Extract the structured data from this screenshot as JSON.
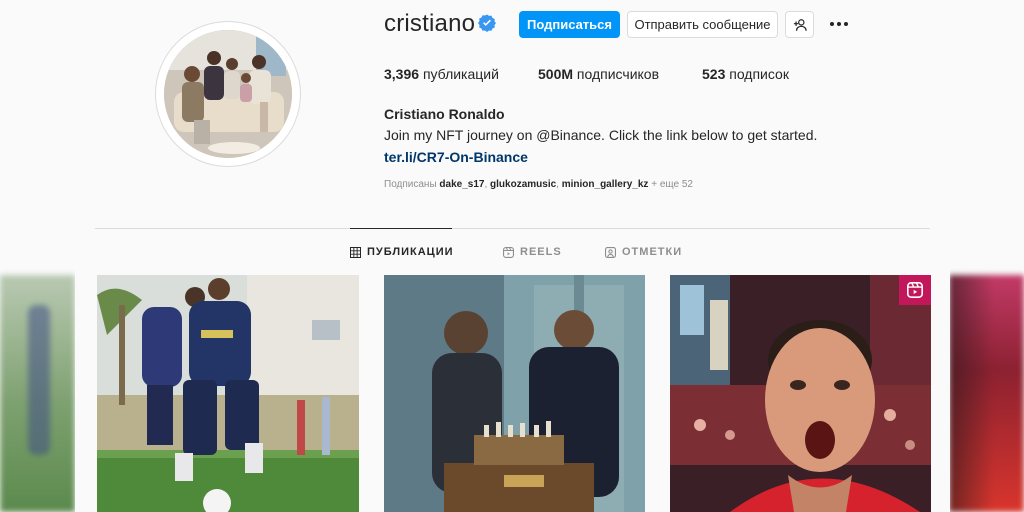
{
  "profile": {
    "username": "cristiano",
    "follow_label": "Подписаться",
    "message_label": "Отправить сообщение",
    "stats": {
      "posts_count": "3,396",
      "posts_label": "публикаций",
      "followers_count": "500M",
      "followers_label": "подписчиков",
      "following_count": "523",
      "following_label": "подписок"
    },
    "full_name": "Cristiano Ronaldo",
    "bio": "Join my NFT journey on @Binance. Click the link below to get started.",
    "link": "ter.li/CR7-On-Binance",
    "followed_by": {
      "prefix": "Подписаны",
      "users": [
        "dake_s17",
        "glukozamusic",
        "minion_gallery_kz"
      ],
      "more": "+ еще 52"
    }
  },
  "tabs": [
    {
      "label": "ПУБЛИКАЦИИ",
      "icon": "grid-icon",
      "active": true
    },
    {
      "label": "REELS",
      "icon": "reels-icon",
      "active": false
    },
    {
      "label": "ОТМЕТКИ",
      "icon": "tagged-icon",
      "active": false
    }
  ],
  "posts": [
    {
      "subject": "training-photo"
    },
    {
      "subject": "chess-photo"
    },
    {
      "subject": "celebration-reel",
      "badge_icon": "reels-icon"
    }
  ],
  "colors": {
    "accent": "#0095f6",
    "link": "#00376b",
    "verified": "#3897f0"
  }
}
